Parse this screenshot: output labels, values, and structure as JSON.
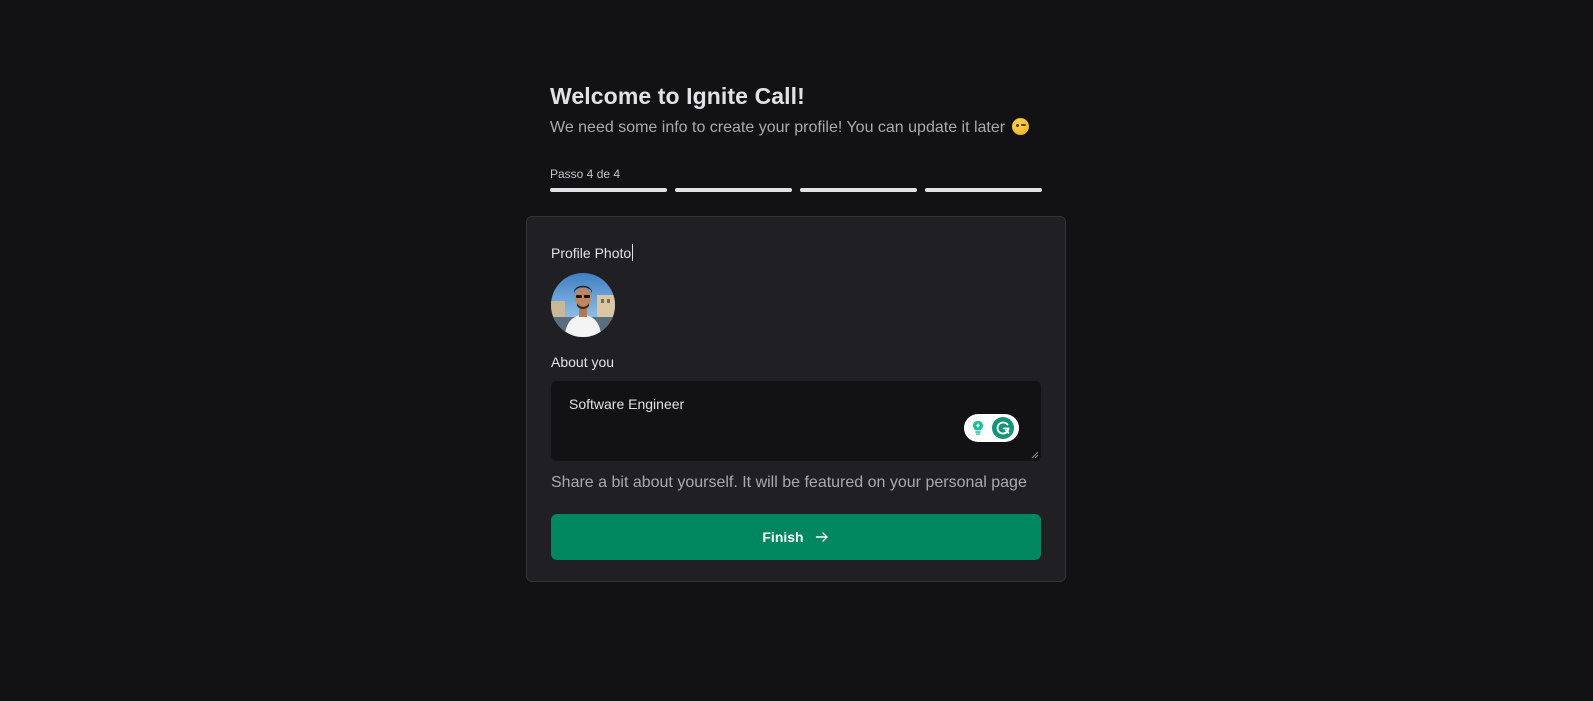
{
  "header": {
    "title": "Welcome to Ignite Call!",
    "subtitle": "We need some info to create your profile! You can update it later",
    "subtitle_emoji": "winking-face-emoji"
  },
  "progress": {
    "label": "Passo 4 de 4",
    "current_step": 4,
    "total_steps": 4
  },
  "form": {
    "photo_label": "Profile Photo",
    "about_label": "About you",
    "about_value": "Software Engineer",
    "about_helper": "Share a bit about yourself. It will be featured on your personal page",
    "submit_label": "Finish",
    "submit_icon": "arrow-right-icon",
    "extension_icons": [
      "lightbulb-icon",
      "grammarly-icon"
    ]
  },
  "colors": {
    "background": "#121214",
    "card": "#202024",
    "accent": "#00875f",
    "text": "#e1e1e6",
    "muted": "#a9a9b2"
  }
}
